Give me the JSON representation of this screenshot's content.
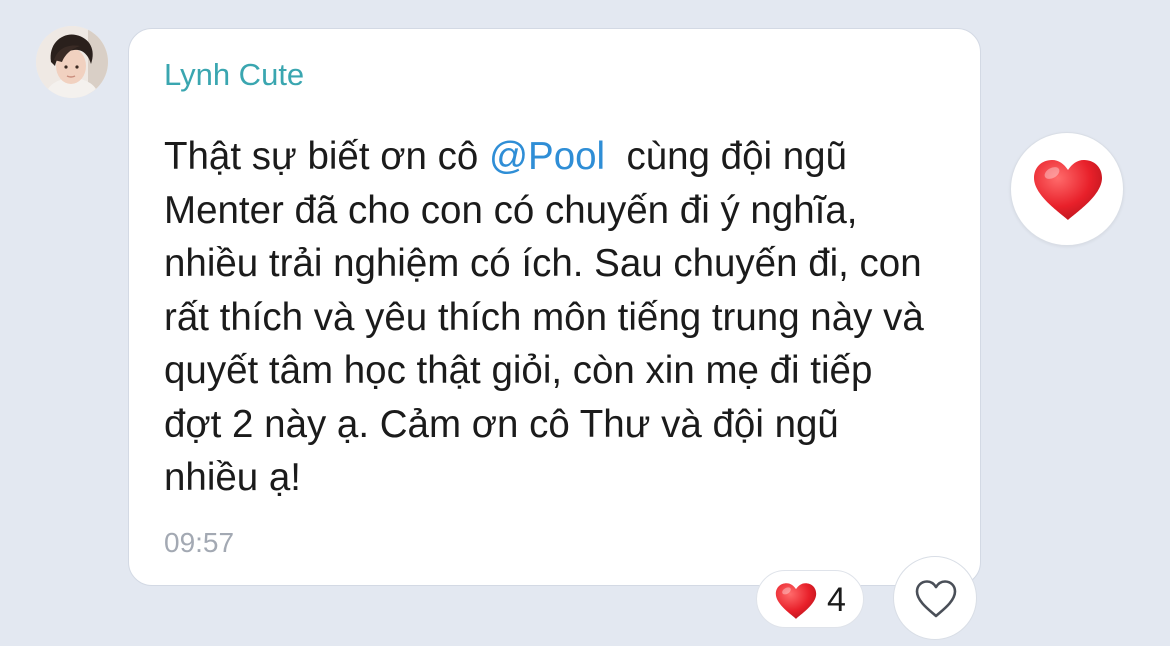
{
  "message": {
    "sender": "Lynh Cute",
    "text_before_mention": "Thật sự biết ơn cô ",
    "mention": "@Pool",
    "text_after_mention": "  cùng đội ngũ Menter đã cho con có chuyến đi ý nghĩa, nhiều trải nghiệm có ích. Sau chuyến đi, con rất thích và yêu thích môn tiếng trung này và quyết tâm học thật giỏi, còn xin mẹ đi tiếp đợt 2 này ạ. Cảm ơn cô Thư và đội ngũ nhiều ạ!",
    "time": "09:57"
  },
  "reactions": {
    "heart_count": "4"
  },
  "icons": {
    "quick_reaction": "heart-icon",
    "reaction_summary": "heart-icon",
    "react_button": "heart-outline-icon"
  },
  "colors": {
    "background": "#e3e8f1",
    "sender_name": "#3aa6b0",
    "mention": "#2f8ed6",
    "heart": "#e8202a",
    "timestamp": "#a3a9b3"
  }
}
